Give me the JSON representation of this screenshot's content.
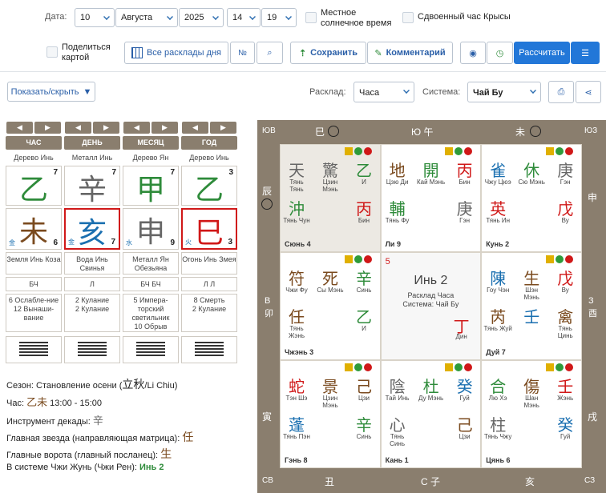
{
  "top": {
    "date_label": "Дата:",
    "day": "10",
    "month": "Августа",
    "year": "2025",
    "hour": "14",
    "minute": "19",
    "local_time": "Местное солнечное время",
    "double_rat": "Сдвоенный час Крысы",
    "share": "Поделиться картой",
    "all_charts": "Все расклады дня",
    "save": "Сохранить",
    "comment": "Комментарий",
    "calc": "Рассчитать",
    "show_hide": "Показать/скрыть",
    "layout_label": "Расклад:",
    "layout_value": "Часа",
    "system_label": "Система:",
    "system_value": "Чай Бу"
  },
  "pillars": [
    {
      "head": "ЧАС",
      "top": "Дерево Инь",
      "stem": "乙",
      "stem_n": "7",
      "branch": "未",
      "branch_n": "6",
      "branch_el": "金",
      "desc": "Земля Инь Коза",
      "sym": "БЧ",
      "star": "6 Ослабле-ние\n12 Вынаши-вание"
    },
    {
      "head": "ДЕНЬ",
      "top": "Металл Инь",
      "stem": "辛",
      "stem_n": "7",
      "branch": "亥",
      "branch_n": "7",
      "branch_el": "金",
      "desc": "Вода Инь Свинья",
      "sym": "Л",
      "star": "2 Кулание\n2 Кулание"
    },
    {
      "head": "МЕСЯЦ",
      "top": "Дерево Ян",
      "stem": "甲",
      "stem_n": "7",
      "branch": "申",
      "branch_n": "9",
      "branch_el": "水",
      "desc": "Металл Ян Обезьяна",
      "sym": "БЧ БЧ",
      "star": "5 Импера-торский светильник\n10 Обрыв"
    },
    {
      "head": "ГОД",
      "top": "Дерево Инь",
      "stem": "乙",
      "stem_n": "3",
      "branch": "巳",
      "branch_n": "3",
      "branch_el": "火",
      "desc": "Огонь Инь Змея",
      "sym": "Л Л",
      "star": "8 Смерть\n2 Кулание"
    }
  ],
  "info": {
    "season": "Сезон: Становление осени (",
    "season_h": "立秋",
    "season_e": "/Li Chiu)",
    "hour_l": "Час:",
    "hour_v": "乙未",
    "hour_t": "13:00 - 15:00",
    "decade_l": "Инструмент декады:",
    "decade_v": "辛",
    "star_l": "Главная звезда (направляющая матрица):",
    "star_v": "任",
    "gate_l": "Главные ворота (главный посланец):",
    "gate_v": "生",
    "sys_l": "В системе Чжи Жунь (Чжи Рен):",
    "sys_v": "Инь 2"
  },
  "board": {
    "dirs": {
      "nw": "ЮВ",
      "s": "Ю 午",
      "n_l": "巳",
      "n_r": "未",
      "ne": "ЮЗ",
      "w1": "辰",
      "w2": "В 卯",
      "w3": "寅",
      "e1": "申",
      "e2": "З 酉",
      "e3": "戌",
      "sw": "СВ",
      "b1": "丑",
      "b2": "С 子",
      "b3": "亥",
      "se": "СЗ"
    },
    "center": {
      "num": "5",
      "title": "Инь 2",
      "l1": "Расклад Часа",
      "l2": "Система: Чай Бу",
      "stem": "丁",
      "stem_l": "Дин"
    },
    "palaces": [
      {
        "name": "Сюнь 4",
        "a": "天",
        "al": "Тянь Тянь",
        "b": "驚",
        "bl": "Цзин Мэнь",
        "c": "乙",
        "cl": "И",
        "d": "沖",
        "dl": "Тянь Чун",
        "e": "丙",
        "el": "Бин"
      },
      {
        "name": "Ли 9",
        "a": "地",
        "al": "Цзю Ди",
        "b": "開",
        "bl": "Кай Мэнь",
        "c": "丙",
        "cl": "Бин",
        "d": "輔",
        "dl": "Тянь Фу",
        "e": "庚",
        "el": "Гэн"
      },
      {
        "name": "Кунь 2",
        "a": "雀",
        "al": "Чжу Цюэ",
        "b": "休",
        "bl": "Сю Мэнь",
        "c": "庚",
        "cl": "Гэн",
        "d": "英",
        "dl": "Тянь Ин",
        "e": "戊",
        "el": "Ву"
      },
      {
        "name": "Чжэнь 3",
        "a": "符",
        "al": "Чжи Фу",
        "b": "死",
        "bl": "Сы Мэнь",
        "c": "辛",
        "cl": "Синь",
        "d": "任",
        "dl": "Тянь Жэнь",
        "e": "乙",
        "el": "И"
      },
      {
        "name": "Дуй 7",
        "a": "陳",
        "al": "Гоу Чэн",
        "b": "生",
        "bl": "Шэн Мэнь",
        "c": "戊",
        "cl": "Ву",
        "d": "芮",
        "dl": "Тянь Жуй",
        "e": "禽",
        "el": "Тянь Цинь",
        "f": "壬",
        "fl": "Жэнь"
      },
      {
        "name": "Гэнь 8",
        "a": "蛇",
        "al": "Тэн Шэ",
        "b": "景",
        "bl": "Цзин Мэнь",
        "c": "己",
        "cl": "Цзи",
        "d": "蓬",
        "dl": "Тянь Пэн",
        "e": "辛",
        "el": "Синь"
      },
      {
        "name": "Кань 1",
        "a": "陰",
        "al": "Тай Инь",
        "b": "杜",
        "bl": "Ду Мэнь",
        "c": "癸",
        "cl": "Гуй",
        "d": "心",
        "dl": "Тянь Синь",
        "e": "己",
        "el": "Цзи"
      },
      {
        "name": "Цянь 6",
        "a": "合",
        "al": "Лю Хэ",
        "b": "傷",
        "bl": "Шан Мэнь",
        "c": "壬",
        "cl": "Жэнь",
        "d": "柱",
        "dl": "Тянь Чжу",
        "e": "癸",
        "el": "Гуй"
      }
    ]
  }
}
